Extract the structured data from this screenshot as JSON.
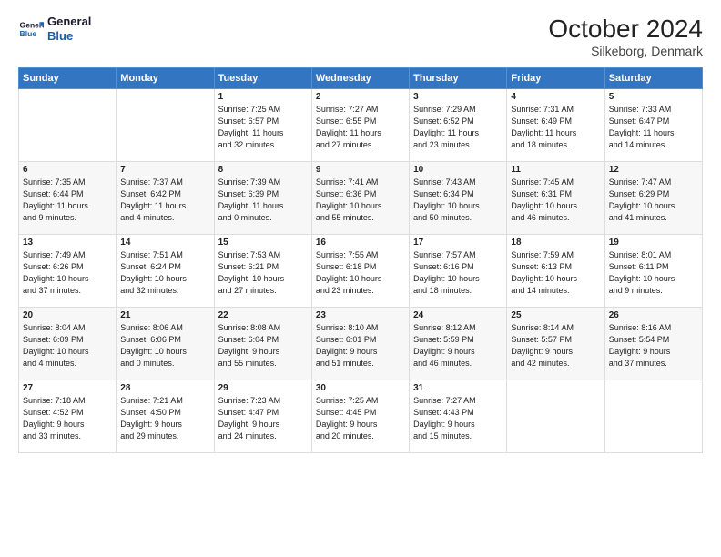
{
  "header": {
    "logo_line1": "General",
    "logo_line2": "Blue",
    "month": "October 2024",
    "location": "Silkeborg, Denmark"
  },
  "weekdays": [
    "Sunday",
    "Monday",
    "Tuesday",
    "Wednesday",
    "Thursday",
    "Friday",
    "Saturday"
  ],
  "weeks": [
    [
      {
        "day": "",
        "content": ""
      },
      {
        "day": "",
        "content": ""
      },
      {
        "day": "1",
        "content": "Sunrise: 7:25 AM\nSunset: 6:57 PM\nDaylight: 11 hours\nand 32 minutes."
      },
      {
        "day": "2",
        "content": "Sunrise: 7:27 AM\nSunset: 6:55 PM\nDaylight: 11 hours\nand 27 minutes."
      },
      {
        "day": "3",
        "content": "Sunrise: 7:29 AM\nSunset: 6:52 PM\nDaylight: 11 hours\nand 23 minutes."
      },
      {
        "day": "4",
        "content": "Sunrise: 7:31 AM\nSunset: 6:49 PM\nDaylight: 11 hours\nand 18 minutes."
      },
      {
        "day": "5",
        "content": "Sunrise: 7:33 AM\nSunset: 6:47 PM\nDaylight: 11 hours\nand 14 minutes."
      }
    ],
    [
      {
        "day": "6",
        "content": "Sunrise: 7:35 AM\nSunset: 6:44 PM\nDaylight: 11 hours\nand 9 minutes."
      },
      {
        "day": "7",
        "content": "Sunrise: 7:37 AM\nSunset: 6:42 PM\nDaylight: 11 hours\nand 4 minutes."
      },
      {
        "day": "8",
        "content": "Sunrise: 7:39 AM\nSunset: 6:39 PM\nDaylight: 11 hours\nand 0 minutes."
      },
      {
        "day": "9",
        "content": "Sunrise: 7:41 AM\nSunset: 6:36 PM\nDaylight: 10 hours\nand 55 minutes."
      },
      {
        "day": "10",
        "content": "Sunrise: 7:43 AM\nSunset: 6:34 PM\nDaylight: 10 hours\nand 50 minutes."
      },
      {
        "day": "11",
        "content": "Sunrise: 7:45 AM\nSunset: 6:31 PM\nDaylight: 10 hours\nand 46 minutes."
      },
      {
        "day": "12",
        "content": "Sunrise: 7:47 AM\nSunset: 6:29 PM\nDaylight: 10 hours\nand 41 minutes."
      }
    ],
    [
      {
        "day": "13",
        "content": "Sunrise: 7:49 AM\nSunset: 6:26 PM\nDaylight: 10 hours\nand 37 minutes."
      },
      {
        "day": "14",
        "content": "Sunrise: 7:51 AM\nSunset: 6:24 PM\nDaylight: 10 hours\nand 32 minutes."
      },
      {
        "day": "15",
        "content": "Sunrise: 7:53 AM\nSunset: 6:21 PM\nDaylight: 10 hours\nand 27 minutes."
      },
      {
        "day": "16",
        "content": "Sunrise: 7:55 AM\nSunset: 6:18 PM\nDaylight: 10 hours\nand 23 minutes."
      },
      {
        "day": "17",
        "content": "Sunrise: 7:57 AM\nSunset: 6:16 PM\nDaylight: 10 hours\nand 18 minutes."
      },
      {
        "day": "18",
        "content": "Sunrise: 7:59 AM\nSunset: 6:13 PM\nDaylight: 10 hours\nand 14 minutes."
      },
      {
        "day": "19",
        "content": "Sunrise: 8:01 AM\nSunset: 6:11 PM\nDaylight: 10 hours\nand 9 minutes."
      }
    ],
    [
      {
        "day": "20",
        "content": "Sunrise: 8:04 AM\nSunset: 6:09 PM\nDaylight: 10 hours\nand 4 minutes."
      },
      {
        "day": "21",
        "content": "Sunrise: 8:06 AM\nSunset: 6:06 PM\nDaylight: 10 hours\nand 0 minutes."
      },
      {
        "day": "22",
        "content": "Sunrise: 8:08 AM\nSunset: 6:04 PM\nDaylight: 9 hours\nand 55 minutes."
      },
      {
        "day": "23",
        "content": "Sunrise: 8:10 AM\nSunset: 6:01 PM\nDaylight: 9 hours\nand 51 minutes."
      },
      {
        "day": "24",
        "content": "Sunrise: 8:12 AM\nSunset: 5:59 PM\nDaylight: 9 hours\nand 46 minutes."
      },
      {
        "day": "25",
        "content": "Sunrise: 8:14 AM\nSunset: 5:57 PM\nDaylight: 9 hours\nand 42 minutes."
      },
      {
        "day": "26",
        "content": "Sunrise: 8:16 AM\nSunset: 5:54 PM\nDaylight: 9 hours\nand 37 minutes."
      }
    ],
    [
      {
        "day": "27",
        "content": "Sunrise: 7:18 AM\nSunset: 4:52 PM\nDaylight: 9 hours\nand 33 minutes."
      },
      {
        "day": "28",
        "content": "Sunrise: 7:21 AM\nSunset: 4:50 PM\nDaylight: 9 hours\nand 29 minutes."
      },
      {
        "day": "29",
        "content": "Sunrise: 7:23 AM\nSunset: 4:47 PM\nDaylight: 9 hours\nand 24 minutes."
      },
      {
        "day": "30",
        "content": "Sunrise: 7:25 AM\nSunset: 4:45 PM\nDaylight: 9 hours\nand 20 minutes."
      },
      {
        "day": "31",
        "content": "Sunrise: 7:27 AM\nSunset: 4:43 PM\nDaylight: 9 hours\nand 15 minutes."
      },
      {
        "day": "",
        "content": ""
      },
      {
        "day": "",
        "content": ""
      }
    ]
  ]
}
